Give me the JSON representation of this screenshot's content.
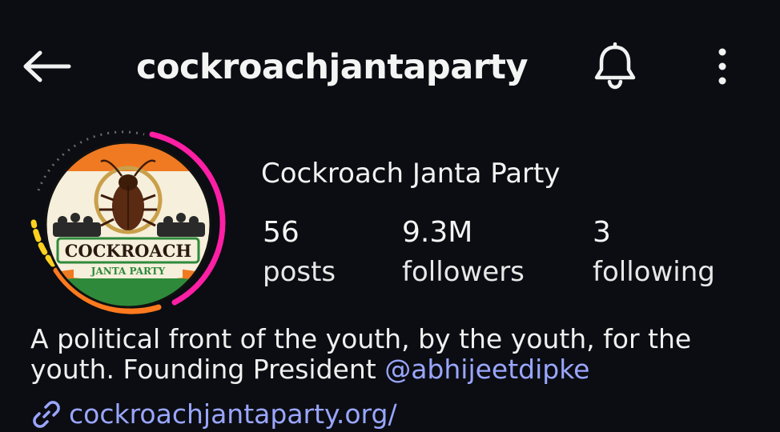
{
  "header": {
    "username": "cockroachjantaparty",
    "back_icon": "arrow-left-icon",
    "bell_icon": "bell-icon",
    "more_icon": "more-vertical-icon"
  },
  "profile": {
    "display_name": "Cockroach Janta Party",
    "avatar": {
      "logo_line1": "COCKROACH",
      "logo_line2": "JANTA PARTY",
      "story_ring_colors": [
        "#ff1fa5",
        "#ff7a1f",
        "#ffd21f"
      ]
    },
    "stats": [
      {
        "value": "56",
        "label": "posts"
      },
      {
        "value": "9.3M",
        "label": "followers"
      },
      {
        "value": "3",
        "label": "following"
      }
    ],
    "bio_text": "A political front of the youth, by the youth, for the youth. Founding President ",
    "bio_mention": "@abhijeetdipke",
    "link_icon": "link-icon",
    "link": "cockroachjantaparty.org/"
  },
  "colors": {
    "background": "#0b0d12",
    "text": "#f2f2f2",
    "link": "#9aa6ff"
  }
}
